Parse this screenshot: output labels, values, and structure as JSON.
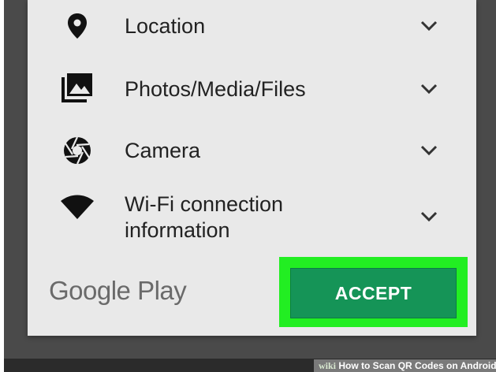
{
  "permissions": [
    {
      "label": "Location",
      "icon": "location-pin-icon"
    },
    {
      "label": "Photos/Media/Files",
      "icon": "photos-icon"
    },
    {
      "label": "Camera",
      "icon": "camera-aperture-icon"
    },
    {
      "label": "Wi-Fi connection\ninformation",
      "icon": "wifi-icon"
    }
  ],
  "footer": {
    "logo_text": "Google Play",
    "accept_label": "ACCEPT"
  },
  "watermark": {
    "brand": "wiki",
    "text": "How to Scan QR Codes on Android"
  },
  "colors": {
    "accept_button": "#159457",
    "highlight": "#22ee22",
    "dialog_bg": "#e9e9e9"
  }
}
